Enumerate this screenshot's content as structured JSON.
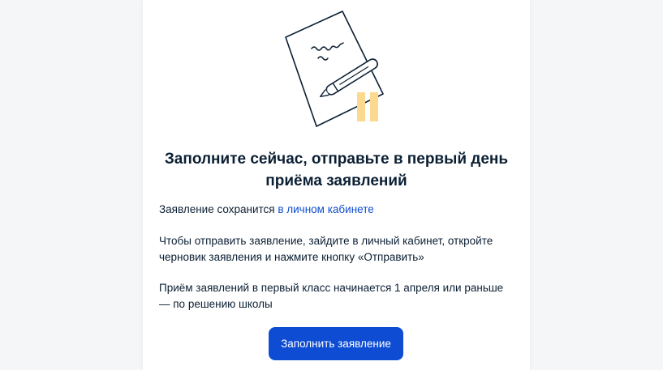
{
  "title": "Заполните сейчас, отправьте в первый день приёма заявлений",
  "info": {
    "p1_text": "Заявление сохранится ",
    "p1_link": "в личном кабинете",
    "p2": "Чтобы отправить заявление, зайдите в личный кабинет, откройте черновик заявления и нажмите кнопку «Отправить»",
    "p3": "Приём заявлений в первый класс начинается 1 апреля или раньше — по решению школы"
  },
  "action": {
    "fill_button_label": "Заполнить заявление"
  },
  "colors": {
    "accent": "#0d4cd3",
    "pause_bars": "#fbd98e",
    "text": "#0b1f33"
  },
  "icons": {
    "illustration": "document-with-pen-pause-icon"
  }
}
